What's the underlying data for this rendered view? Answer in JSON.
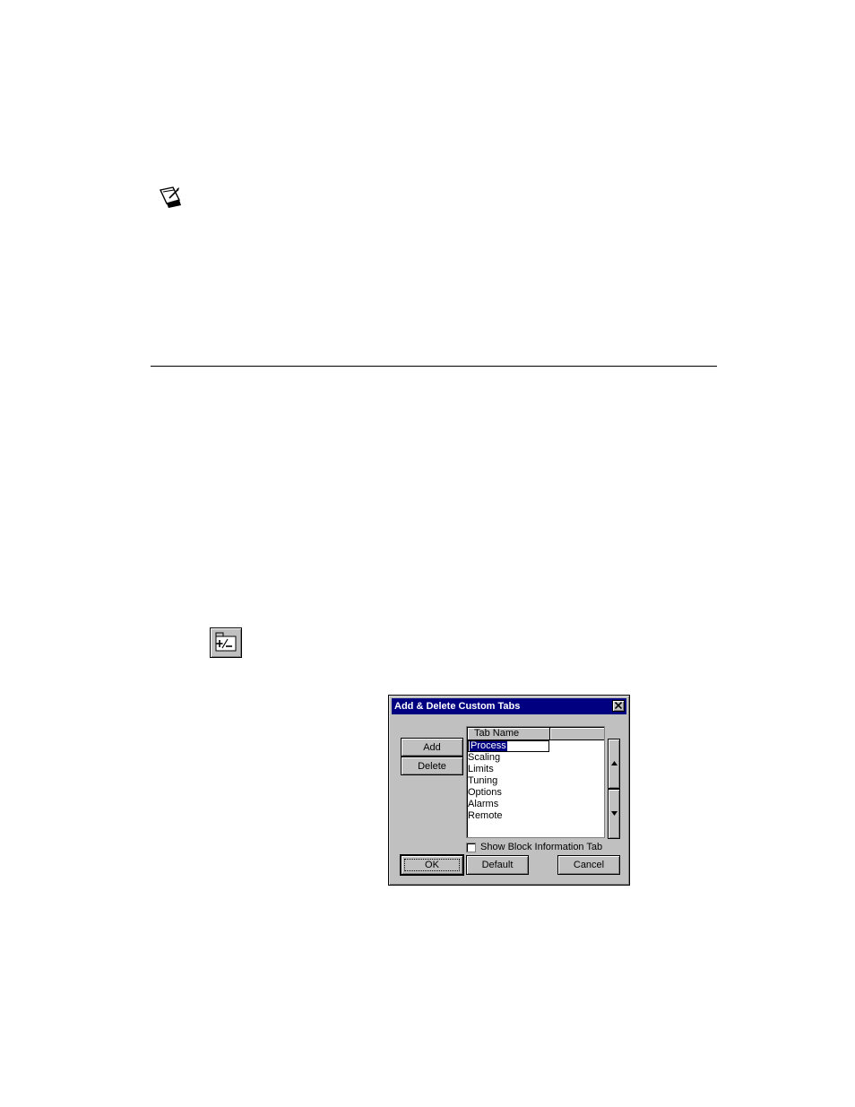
{
  "icons": {
    "note": "note-icon",
    "add_delete_tabs_tool": "add-delete-tabs-icon"
  },
  "dialog": {
    "title": "Add & Delete Custom Tabs",
    "buttons": {
      "add": "Add",
      "delete": "Delete",
      "ok": "OK",
      "default": "Default",
      "cancel": "Cancel"
    },
    "list": {
      "column_header": "Tab Name",
      "editing_value": "Process",
      "items": [
        "Scaling",
        "Limits",
        "Tuning",
        "Options",
        "Alarms",
        "Remote"
      ]
    },
    "checkbox": {
      "label": "Show Block Information Tab",
      "checked": false
    },
    "colors": {
      "titlebar": "#000080",
      "face": "#c0c0c0",
      "selection": "#000080"
    }
  }
}
